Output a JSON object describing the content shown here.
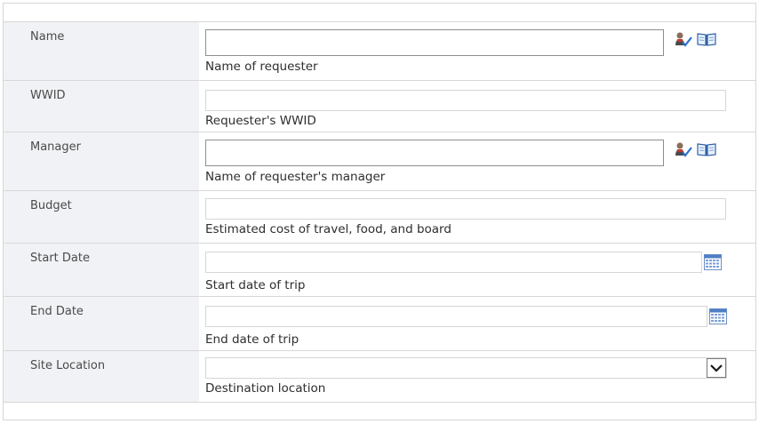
{
  "form": {
    "fields": [
      {
        "label": "Name",
        "description": "Name of requester",
        "value": "",
        "icons": [
          "check-names-icon",
          "browse-address-book-icon"
        ]
      },
      {
        "label": "WWID",
        "description": "Requester's WWID",
        "value": ""
      },
      {
        "label": "Manager",
        "description": "Name of requester's manager",
        "value": "",
        "icons": [
          "check-names-icon",
          "browse-address-book-icon"
        ]
      },
      {
        "label": "Budget",
        "description": "Estimated cost of travel, food, and board",
        "value": ""
      },
      {
        "label": "Start Date",
        "description": "Start date of trip",
        "value": "",
        "icons": [
          "calendar-icon"
        ]
      },
      {
        "label": "End Date",
        "description": "End date of trip",
        "value": "",
        "icons": [
          "calendar-icon"
        ]
      },
      {
        "label": "Site Location",
        "description": "Destination location",
        "value": "",
        "icons": [
          "chevron-down-icon"
        ]
      }
    ]
  },
  "colors": {
    "label_bg": "#f0f2f5",
    "border": "#d8d8d8",
    "people_picker_border": "#8e8e8e",
    "calendar_blue": "#4f7fc3",
    "checkmark_blue": "#2a6fc9"
  }
}
